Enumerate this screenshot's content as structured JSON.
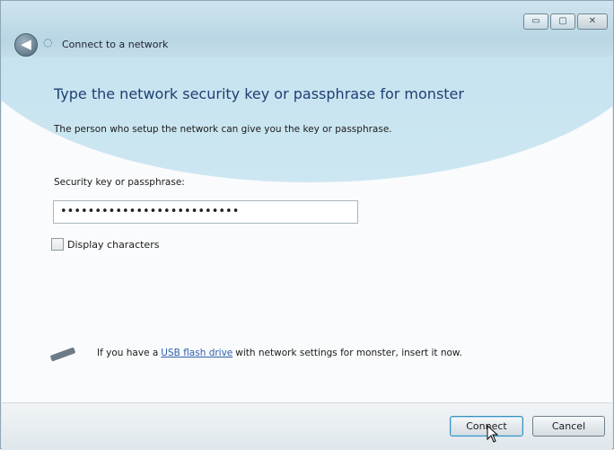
{
  "window": {
    "breadcrumb": "Connect to a network",
    "controls": {
      "minimize": "▭",
      "maximize": "▢",
      "close": "✕"
    }
  },
  "dialog": {
    "heading": "Type the network security key or passphrase for monster",
    "description": "The person who setup the network can give you the key or passphrase.",
    "key_label": "Security key or passphrase:",
    "key_value": "••••••••••••••••••••••••••",
    "checkbox_label": "Display characters",
    "usb_prefix": "If you have a",
    "usb_link": "USB flash drive",
    "usb_suffix": "with network settings for monster, insert it now."
  },
  "buttons": {
    "connect": "Connect",
    "cancel": "Cancel"
  },
  "icons": {
    "back": "back-arrow-icon",
    "network": "network-icon",
    "usb": "usb-drive-icon"
  }
}
